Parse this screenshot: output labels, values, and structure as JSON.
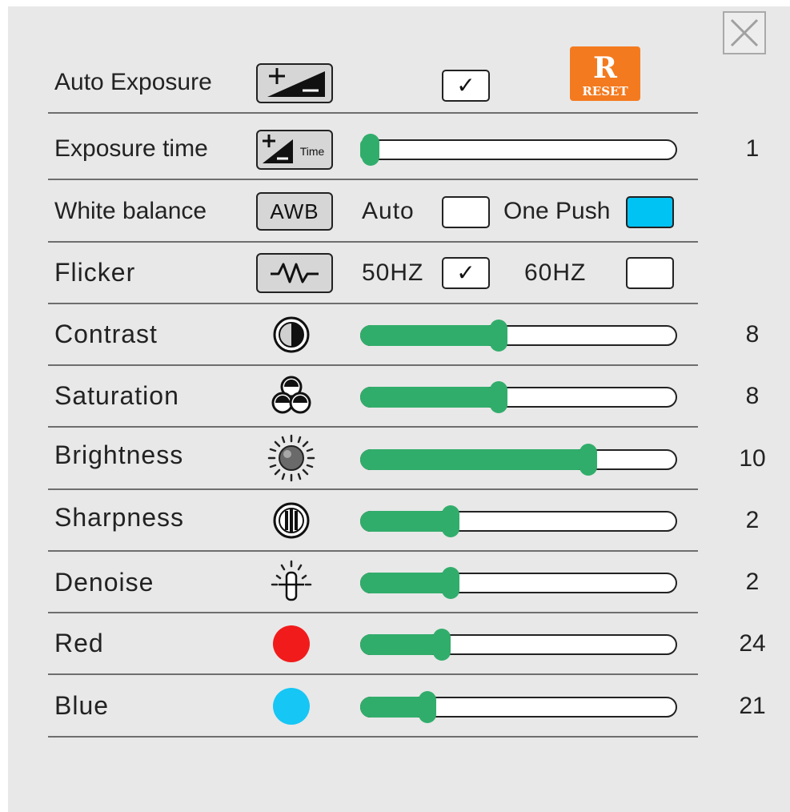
{
  "colors": {
    "panel_bg": "#e8e8e8",
    "slider_fill": "#31ad6b",
    "reset_orange": "#f47a1f",
    "one_push_active": "#00c2f3",
    "red_channel": "#f21b1b",
    "blue_channel": "#16c6f5"
  },
  "close_button": {
    "icon": "close-icon"
  },
  "auto_exposure": {
    "label": "Auto Exposure",
    "icon": "exposure-plus-minus-icon",
    "checked": true
  },
  "reset_button": {
    "label": "RESET",
    "letter": "R",
    "icon": "reset-icon"
  },
  "exposure_time": {
    "label": "Exposure time",
    "icon": "exposure-time-icon",
    "icon_text": "Time",
    "value": "1",
    "level": 0.0
  },
  "white_balance": {
    "label": "White balance",
    "button_label": "AWB",
    "auto_label": "Auto",
    "auto_checked": false,
    "one_push_label": "One Push",
    "one_push_active": true
  },
  "flicker": {
    "label": "Flicker",
    "icon": "flicker-wave-icon",
    "option_50": "50HZ",
    "option_50_checked": true,
    "option_60": "60HZ",
    "option_60_checked": false
  },
  "sliders": [
    {
      "key": "contrast",
      "label": "Contrast",
      "icon": "contrast-icon",
      "value": "8",
      "level": 0.43
    },
    {
      "key": "saturation",
      "label": "Saturation",
      "icon": "saturation-icon",
      "value": "8",
      "level": 0.43
    },
    {
      "key": "brightness",
      "label": "Brightness",
      "icon": "brightness-icon",
      "value": "10",
      "level": 0.73
    },
    {
      "key": "sharpness",
      "label": "Sharpness",
      "icon": "sharpness-icon",
      "value": "2",
      "level": 0.27
    },
    {
      "key": "denoise",
      "label": "Denoise",
      "icon": "denoise-icon",
      "value": "2",
      "level": 0.27
    },
    {
      "key": "red",
      "label": "Red",
      "icon": "red-dot-icon",
      "value": "24",
      "level": 0.24
    },
    {
      "key": "blue",
      "label": "Blue",
      "icon": "blue-dot-icon",
      "value": "21",
      "level": 0.19
    }
  ]
}
